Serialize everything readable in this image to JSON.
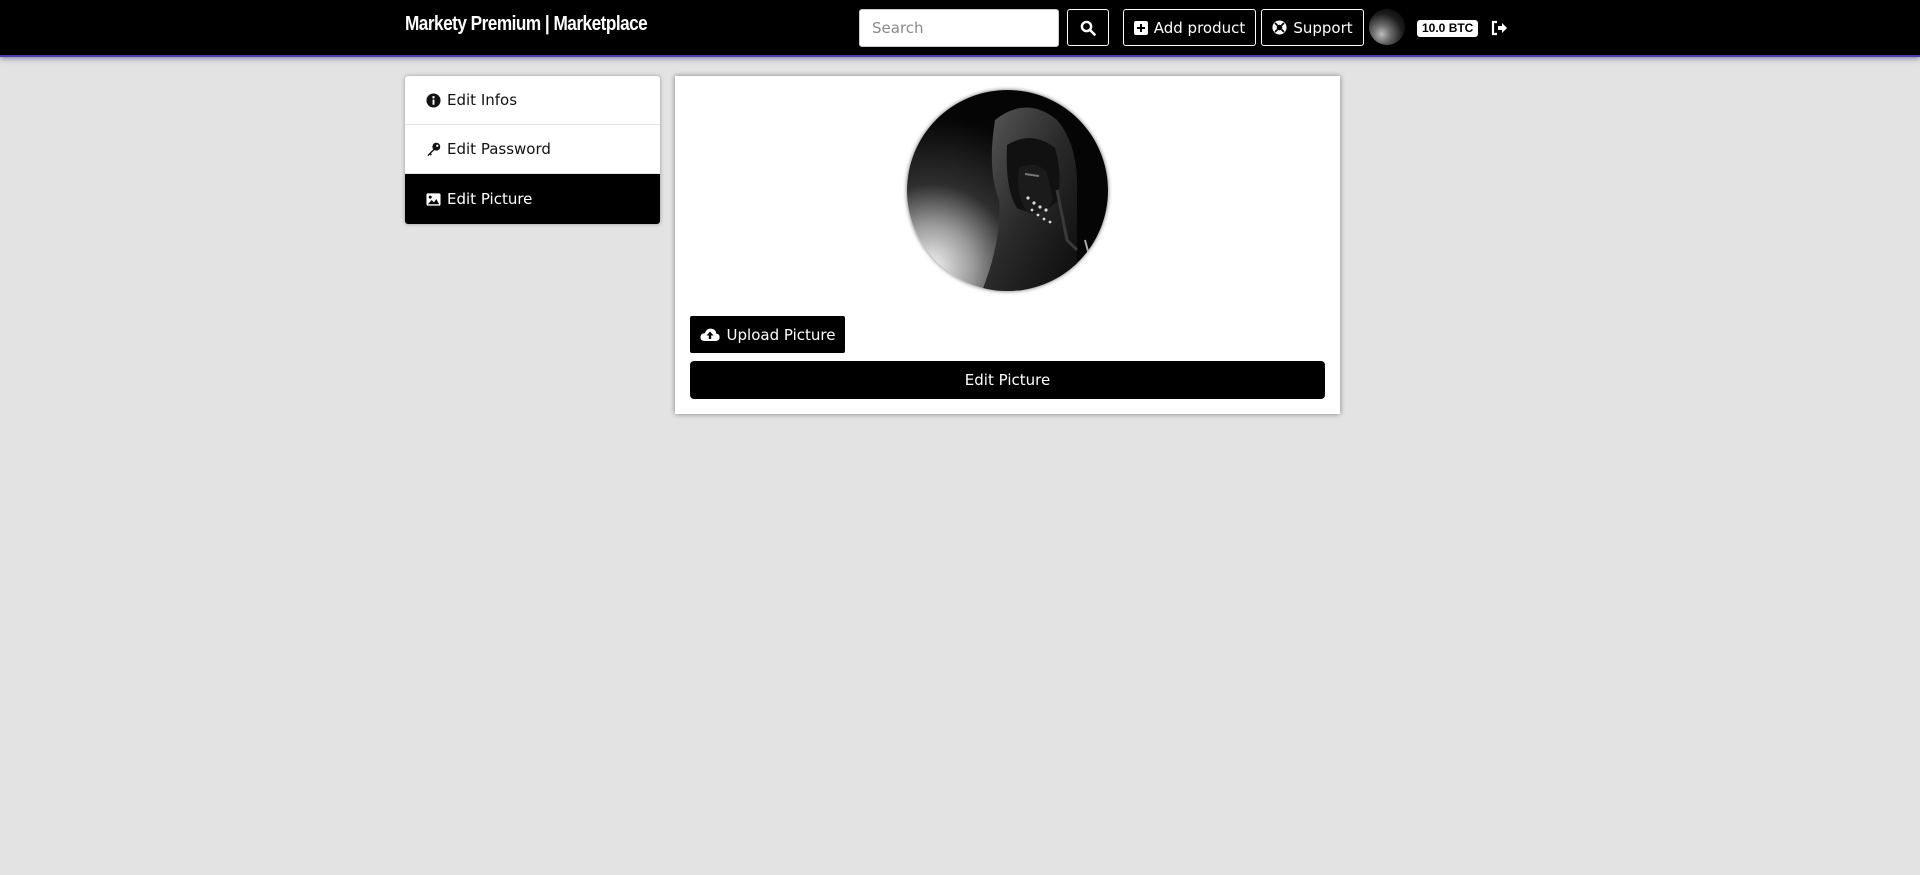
{
  "navbar": {
    "brand": "Markety Premium | Marketplace",
    "search": {
      "placeholder": "Search",
      "value": ""
    },
    "search_button_icon": "search-icon",
    "add_product_label": "Add product",
    "support_label": "Support",
    "balance": "10.0 BTC",
    "logout_icon": "sign-out-icon"
  },
  "side_menu": {
    "items": [
      {
        "label": "Edit Infos",
        "icon": "info-circle-icon",
        "active": false
      },
      {
        "label": "Edit Password",
        "icon": "key-icon",
        "active": false
      },
      {
        "label": "Edit Picture",
        "icon": "image-icon",
        "active": true
      }
    ]
  },
  "card": {
    "upload_label": "Upload Picture",
    "upload_icon": "cloud-upload-icon",
    "submit_label": "Edit Picture"
  },
  "colors": {
    "navbar_bg": "#000000",
    "navbar_accent": "#4a3fa8",
    "page_bg": "#e3e3e3",
    "active_item_bg": "#000000"
  }
}
